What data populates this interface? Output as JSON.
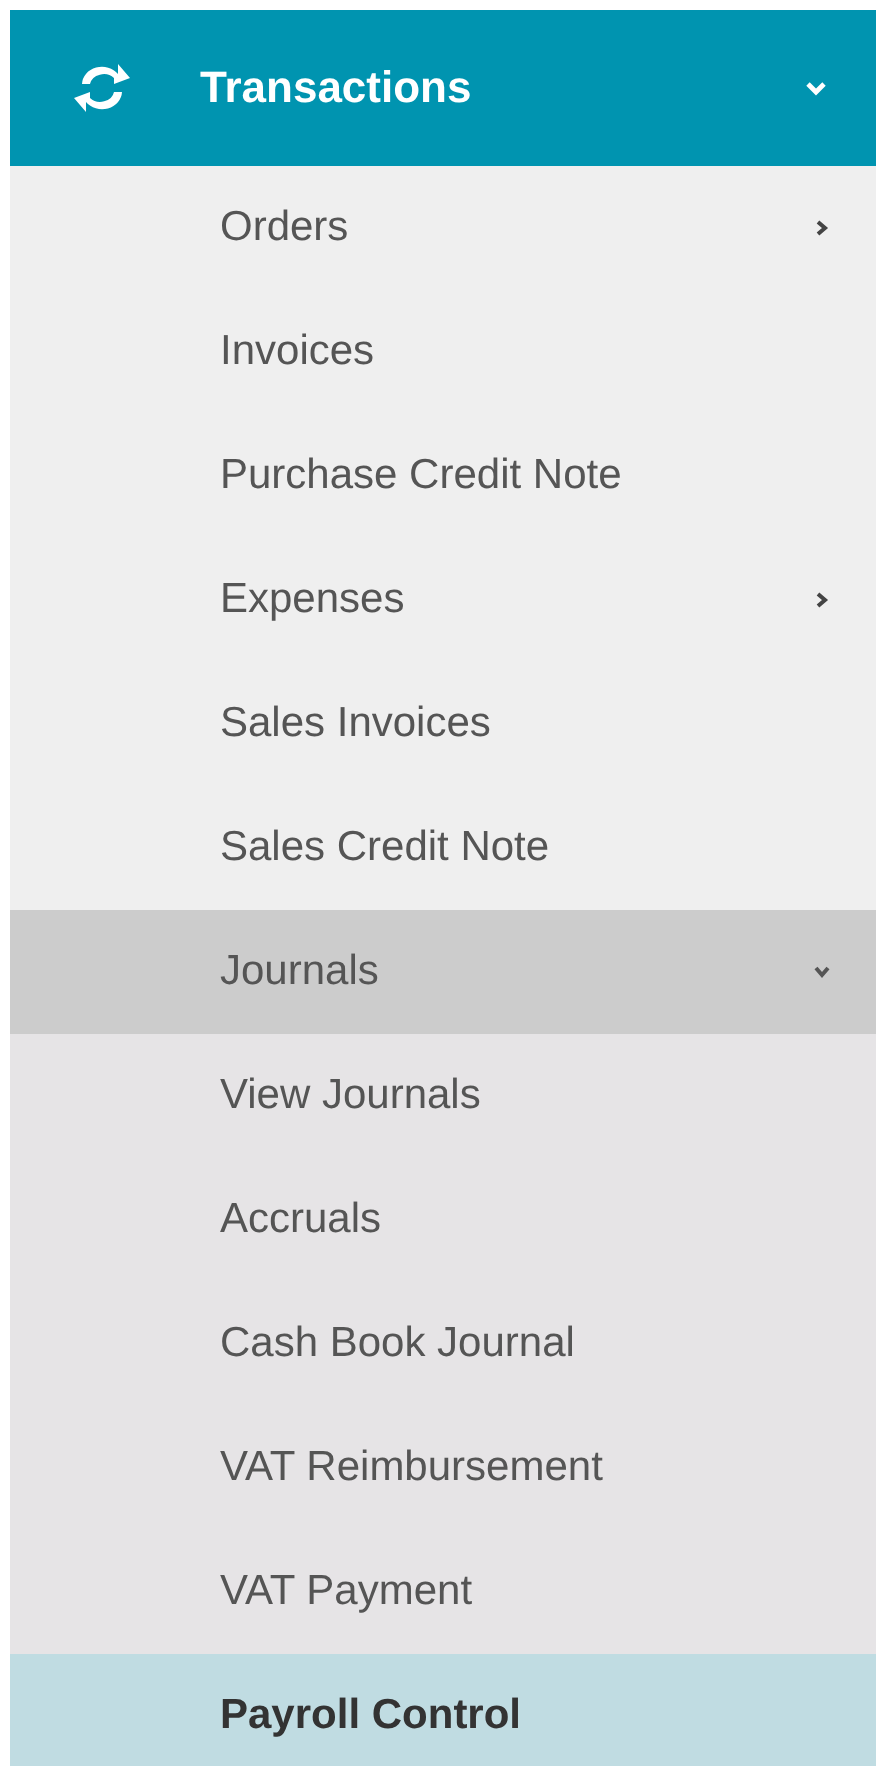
{
  "menu": {
    "title": "Transactions",
    "expanded": true,
    "items": [
      {
        "label": "Orders",
        "has_submenu": true,
        "expanded": false,
        "selected": false
      },
      {
        "label": "Invoices",
        "has_submenu": false,
        "expanded": false,
        "selected": false
      },
      {
        "label": "Purchase Credit Note",
        "has_submenu": false,
        "expanded": false,
        "selected": false
      },
      {
        "label": "Expenses",
        "has_submenu": true,
        "expanded": false,
        "selected": false
      },
      {
        "label": "Sales Invoices",
        "has_submenu": false,
        "expanded": false,
        "selected": false
      },
      {
        "label": "Sales Credit Note",
        "has_submenu": false,
        "expanded": false,
        "selected": false
      },
      {
        "label": "Journals",
        "has_submenu": true,
        "expanded": true,
        "selected": false,
        "children": [
          {
            "label": "View Journals",
            "selected": false
          },
          {
            "label": "Accruals",
            "selected": false
          },
          {
            "label": "Cash Book Journal",
            "selected": false
          },
          {
            "label": "VAT Reimbursement",
            "selected": false
          },
          {
            "label": "VAT Payment",
            "selected": false
          },
          {
            "label": "Payroll Control",
            "selected": true
          }
        ]
      }
    ]
  }
}
